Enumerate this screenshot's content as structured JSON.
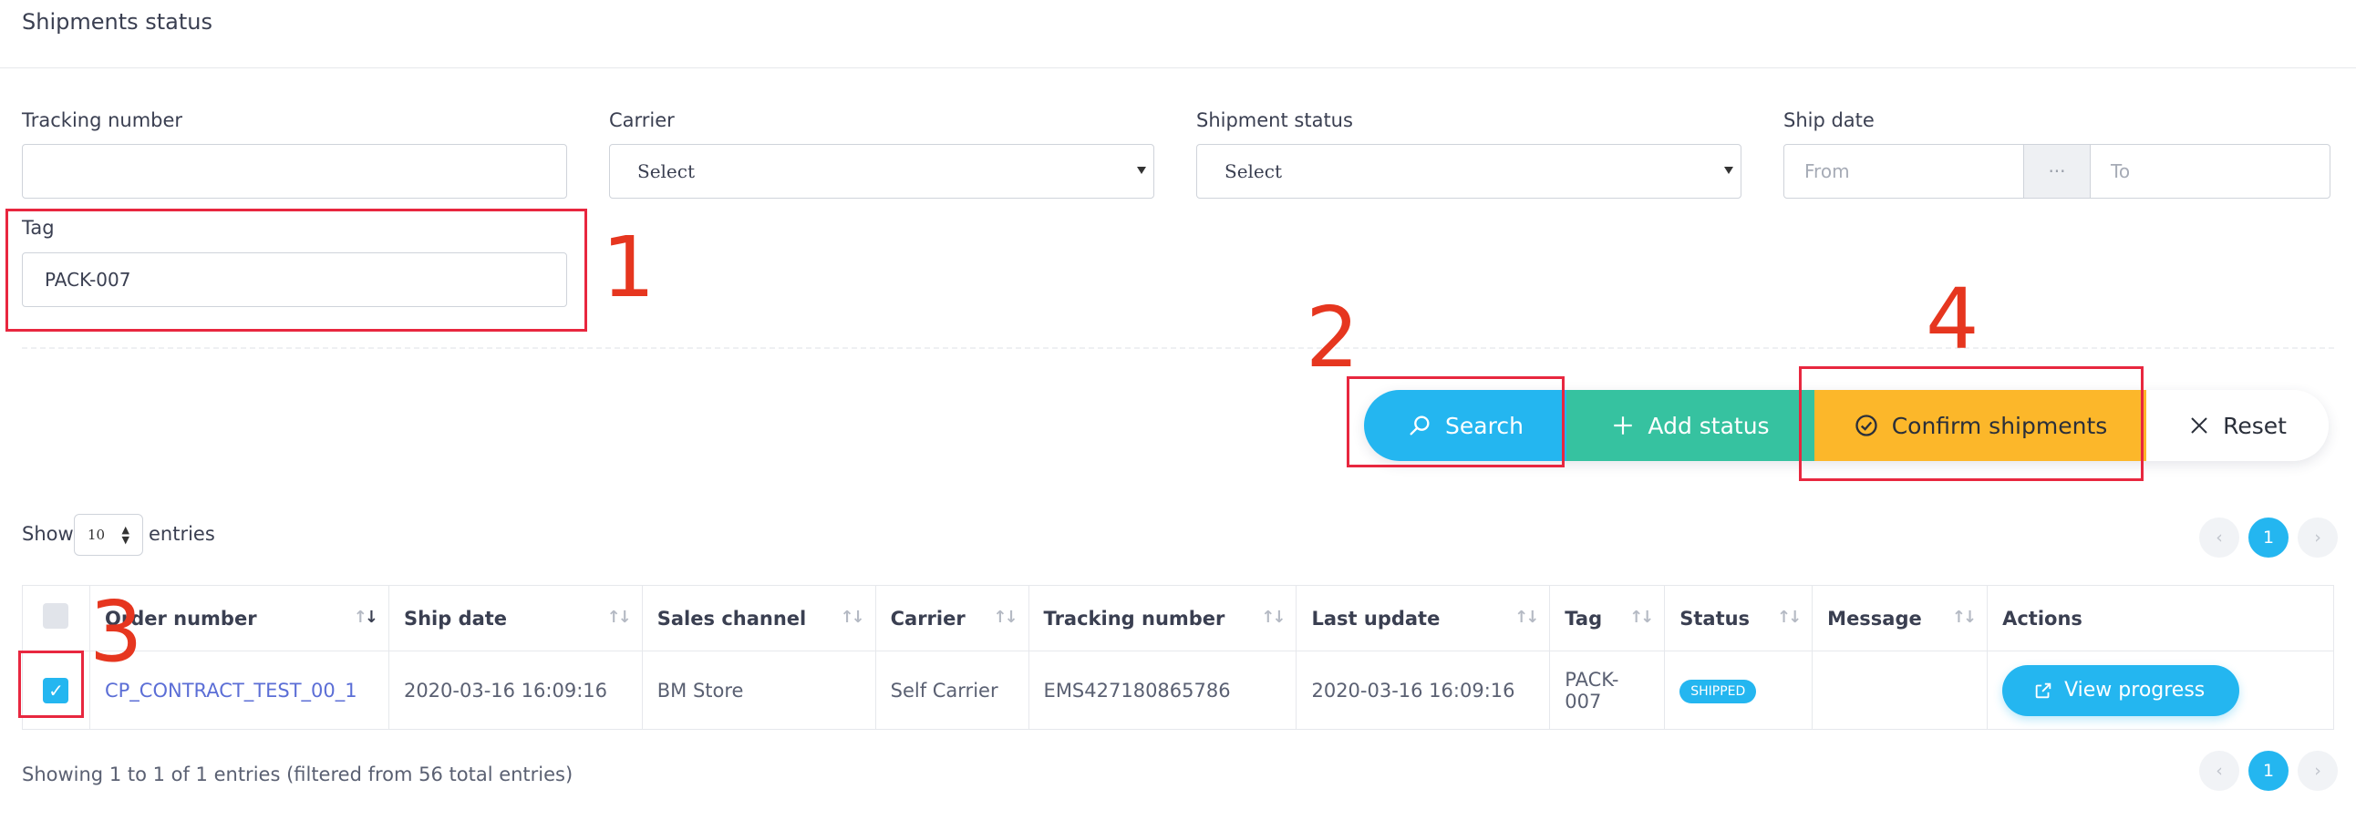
{
  "page": {
    "title": "Shipments status"
  },
  "filters": {
    "tracking_number": {
      "label": "Tracking number",
      "value": ""
    },
    "carrier": {
      "label": "Carrier",
      "value": "Select"
    },
    "shipment_status": {
      "label": "Shipment status",
      "value": "Select"
    },
    "ship_date": {
      "label": "Ship date",
      "from_placeholder": "From",
      "separator": "···",
      "to_placeholder": "To"
    },
    "tag": {
      "label": "Tag",
      "value": "PACK-007"
    }
  },
  "actions": {
    "search": "Search",
    "add_status": "Add status",
    "confirm": "Confirm shipments",
    "reset": "Reset"
  },
  "length": {
    "show": "Show",
    "value": "10",
    "entries": "entries"
  },
  "pagination": {
    "prev": "‹",
    "current": "1",
    "next": "›"
  },
  "table": {
    "headers": [
      "Order number",
      "Ship date",
      "Sales channel",
      "Carrier",
      "Tracking number",
      "Last update",
      "Tag",
      "Status",
      "Message",
      "Actions"
    ],
    "rows": [
      {
        "order_number": "CP_CONTRACT_TEST_00_1",
        "ship_date": "2020-03-16 16:09:16",
        "sales_channel": "BM Store",
        "carrier": "Self Carrier",
        "tracking_number": "EMS427180865786",
        "last_update": "2020-03-16 16:09:16",
        "tag": "PACK-007",
        "status": "SHIPPED",
        "message": "",
        "action": "View progress",
        "checked": true
      }
    ]
  },
  "summary": "Showing 1 to 1 of 1 entries (filtered from 56 total entries)",
  "annotations": [
    "1",
    "2",
    "3",
    "4"
  ],
  "colors": {
    "primary": "#24b6f0",
    "add": "#36c2a0",
    "confirm": "#fcb72a",
    "annotation": "#e8273f",
    "link": "#5b6ed6"
  }
}
